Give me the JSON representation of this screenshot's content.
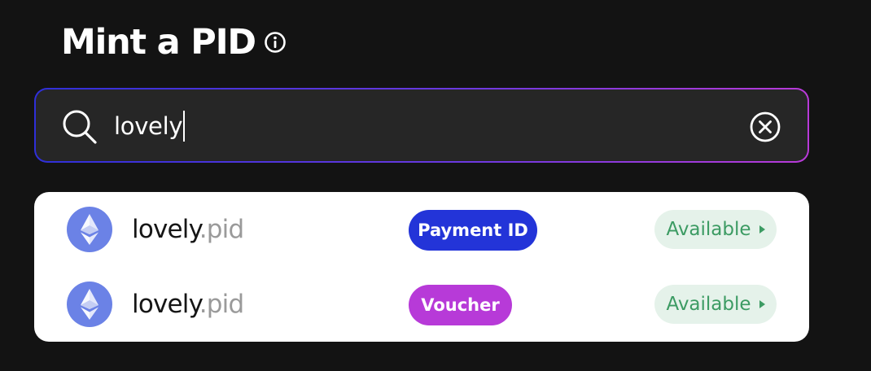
{
  "page": {
    "title": "Mint a PID"
  },
  "icons": {
    "info": "info-circle-icon",
    "search": "search-icon",
    "clear": "clear-circle-icon",
    "token": "ethereum-icon"
  },
  "search": {
    "value": "lovely"
  },
  "colors": {
    "background": "#131313",
    "search_bg": "#262626",
    "gradient_start": "#2f2fd8",
    "gradient_end": "#b93ad8",
    "payment_tag": "#2334d8",
    "voucher_tag": "#b73ad8",
    "available_bg": "#e5f2ea",
    "available_text": "#3c9b63",
    "eth_circle": "#6b82e6"
  },
  "results": [
    {
      "name": "lovely",
      "tld": ".pid",
      "tag": "Payment ID",
      "status": "Available"
    },
    {
      "name": "lovely",
      "tld": ".pid",
      "tag": "Voucher",
      "status": "Available"
    }
  ]
}
